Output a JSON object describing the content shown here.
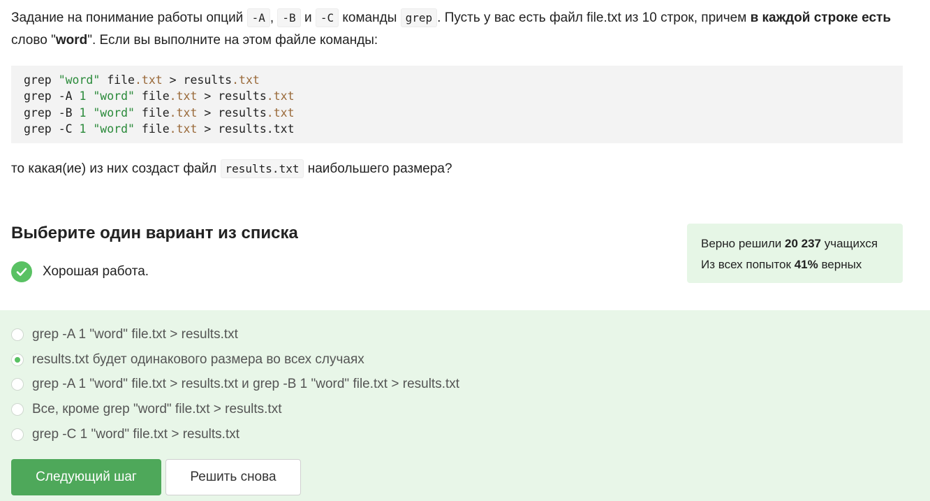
{
  "intro": {
    "t1": "Задание на понимание работы опций ",
    "opt_a": "-A",
    "comma": ", ",
    "opt_b": "-B",
    "and": " и ",
    "opt_c": "-C",
    "t2": " команды ",
    "cmd": "grep",
    "t3": ". Пусть у вас есть файл file.txt из 10 строк, причем ",
    "bold1": "в каждой строке есть",
    "t4": " слово \"",
    "bold2": "word",
    "t5": "\". Если вы выполните на этом файле команды:"
  },
  "code": {
    "lines": [
      {
        "cmd": "grep",
        "flag": "",
        "num": "",
        "str": "\"word\"",
        "file": "file",
        "fext": ".txt",
        "op": ">",
        "out": "results",
        "oext": ".txt"
      },
      {
        "cmd": "grep",
        "flag": "-A",
        "num": "1",
        "str": "\"word\"",
        "file": "file",
        "fext": ".txt",
        "op": ">",
        "out": "results",
        "oext": ".txt"
      },
      {
        "cmd": "grep",
        "flag": "-B",
        "num": "1",
        "str": "\"word\"",
        "file": "file",
        "fext": ".txt",
        "op": ">",
        "out": "results",
        "oext": ".txt"
      },
      {
        "cmd": "grep",
        "flag": "-C",
        "num": "1",
        "str": "\"word\"",
        "file": "file",
        "fext": ".txt",
        "op": ">",
        "out": "results.txt",
        "oext": ""
      }
    ]
  },
  "question": {
    "t1": "то какая(ие) из них создаст файл ",
    "code": "results.txt",
    "t2": " наибольшего размера?"
  },
  "heading": "Выберите один вариант из списка",
  "feedback": "Хорошая работа.",
  "stats": {
    "l1_pre": "Верно решили ",
    "l1_num": "20 237",
    "l1_post": " учащихся",
    "l2_pre": "Из всех попыток ",
    "l2_num": "41%",
    "l2_post": " верных"
  },
  "options": [
    {
      "label": "grep -A 1 \"word\" file.txt > results.txt",
      "checked": false
    },
    {
      "label": "results.txt будет одинакового размера во всех случаях",
      "checked": true
    },
    {
      "label": "grep -A 1 \"word\" file.txt > results.txt и grep -B 1 \"word\" file.txt > results.txt",
      "checked": false
    },
    {
      "label": "Все, кроме grep \"word\" file.txt > results.txt",
      "checked": false
    },
    {
      "label": "grep -C 1 \"word\" file.txt > results.txt",
      "checked": false
    }
  ],
  "buttons": {
    "next": "Следующий шаг",
    "retry": "Решить снова"
  },
  "colors": {
    "accent": "#4ea85a",
    "check": "#59c163",
    "options_bg": "#e8f6e8",
    "stats_bg": "#e6f6e6"
  }
}
